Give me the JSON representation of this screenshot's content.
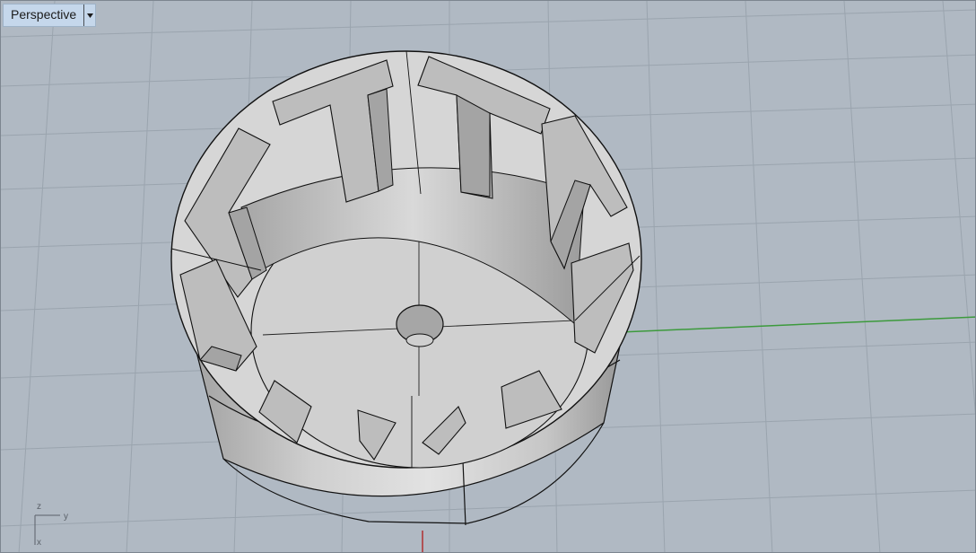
{
  "viewport": {
    "name": "Perspective",
    "dropdown_icon": "chevron-down-icon"
  },
  "axis_widget": {
    "z_label": "z",
    "y_label": "y",
    "x_label": "x"
  },
  "colors": {
    "background": "#b0b9c3",
    "grid": "#9aa4ae",
    "model_fill": "#d7d7d7",
    "model_shadow": "#8f8f8f",
    "edges": "#111111",
    "world_y_axis": "#3c9a3c",
    "world_x_axis": "#b03030",
    "tab_bg": "#c5d7eb"
  }
}
